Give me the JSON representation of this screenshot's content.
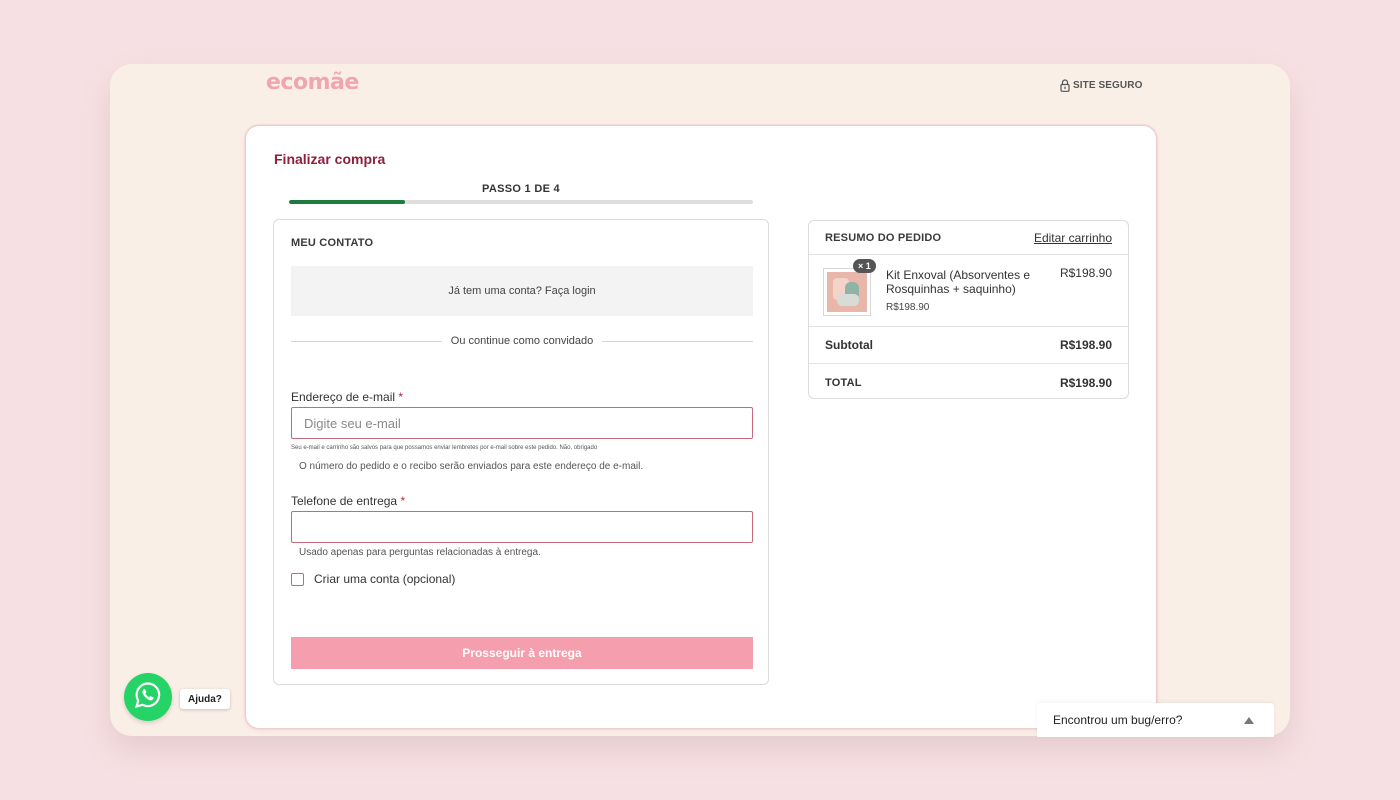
{
  "header": {
    "logo": "ecomãe",
    "secure_label": "SITE SEGURO"
  },
  "checkout": {
    "title": "Finalizar compra",
    "step_label": "PASSO 1 DE 4",
    "step_progress": 0.25,
    "accent_color": "#1f7a40"
  },
  "contact": {
    "heading": "MEU CONTATO",
    "login_prompt": "Já tem uma conta? Faça login",
    "guest_divider": "Ou continue como convidado",
    "email_label": "Endereço de e-mail",
    "required_mark": "*",
    "email_placeholder": "Digite seu e-mail",
    "email_value": "",
    "email_consent_note": "Seu e-mail e carrinho são salvos para que possamos enviar lembretes por e-mail sobre este pedido. Não, obrigado",
    "email_help": "O número do pedido e o recibo serão enviados para este endereço de e-mail.",
    "phone_label": "Telefone de entrega",
    "phone_value": "",
    "phone_help": "Usado apenas para perguntas relacionadas à entrega.",
    "create_account_label": "Criar uma conta (opcional)",
    "create_account_checked": false,
    "proceed_button": "Prosseguir à entrega",
    "proceed_color": "#f59ead"
  },
  "summary": {
    "heading": "RESUMO DO PEDIDO",
    "edit_link": "Editar carrinho",
    "items": [
      {
        "quantity": "× 1",
        "name": "Kit Enxoval (Absorventes e Rosquinhas + saquinho)",
        "unit_price": "R$198.90",
        "price": "R$198.90"
      }
    ],
    "subtotal_label": "Subtotal",
    "subtotal_value": "R$198.90",
    "total_label": "TOTAL",
    "total_value": "R$198.90"
  },
  "widgets": {
    "whatsapp_label": "Ajuda?",
    "whatsapp_icon": "whatsapp-icon",
    "bug_report_label": "Encontrou um bug/erro?"
  }
}
